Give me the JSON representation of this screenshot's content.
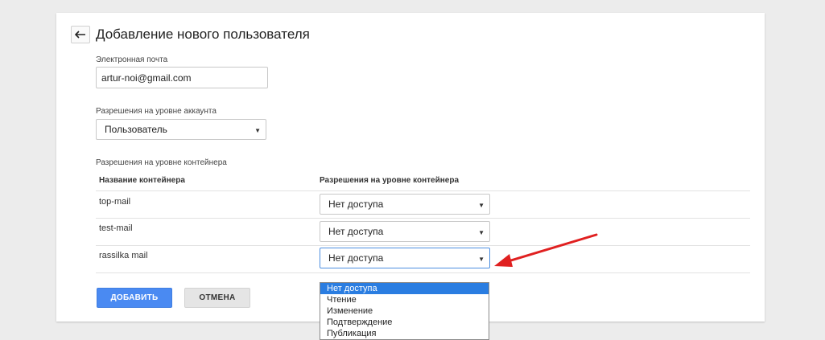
{
  "header": {
    "title": "Добавление нового пользователя"
  },
  "email": {
    "label": "Электронная почта",
    "value": "artur-noi@gmail.com"
  },
  "account_permissions": {
    "label": "Разрешения на уровне аккаунта",
    "selected": "Пользователь"
  },
  "container_permissions": {
    "label": "Разрешения на уровне контейнера",
    "columns": [
      "Название контейнера",
      "Разрешения на уровне контейнера"
    ],
    "rows": [
      {
        "name": "top-mail",
        "permission": "Нет доступа"
      },
      {
        "name": "test-mail",
        "permission": "Нет доступа"
      },
      {
        "name": "rassilka mail",
        "permission": "Нет доступа"
      }
    ]
  },
  "dropdown_options": [
    "Нет доступа",
    "Чтение",
    "Изменение",
    "Подтверждение",
    "Публикация"
  ],
  "actions": {
    "add_label": "ДОБАВИТЬ",
    "cancel_label": "ОТМЕНА"
  },
  "colors": {
    "primary": "#4a8af2",
    "selected_option": "#2a7de1",
    "annotation_arrow": "#e02020"
  },
  "icons": {
    "back": "arrow-left-icon",
    "caret": "caret-down-icon"
  }
}
